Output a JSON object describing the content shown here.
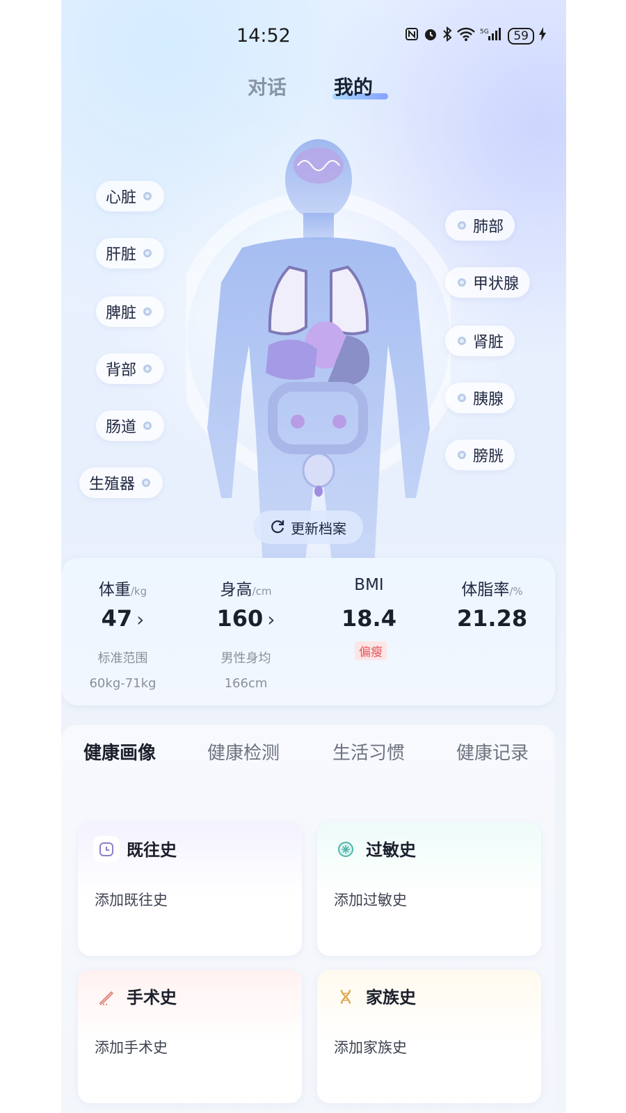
{
  "status_bar": {
    "time": "14:52",
    "icons": [
      "nfc-icon",
      "alarm-icon",
      "bluetooth-icon",
      "wifi-icon",
      "5g-signal-icon",
      "charging-icon"
    ],
    "battery": "59"
  },
  "top_tabs": [
    {
      "label": "对话",
      "active": false
    },
    {
      "label": "我的",
      "active": true
    }
  ],
  "organs_left": [
    "心脏",
    "肝脏",
    "脾脏",
    "背部",
    "肠道",
    "生殖器"
  ],
  "organs_right": [
    "肺部",
    "甲状腺",
    "肾脏",
    "胰腺",
    "膀胱"
  ],
  "refresh_label": "更新档案",
  "metrics": [
    {
      "label": "体重",
      "unit": "/kg",
      "value": "47",
      "sub1": "标准范围",
      "sub2": "60kg-71kg"
    },
    {
      "label": "身高",
      "unit": "/cm",
      "value": "160",
      "sub1": "男性身均",
      "sub2": "166cm"
    },
    {
      "label": "BMI",
      "unit": "",
      "value": "18.4",
      "badge": "偏瘦"
    },
    {
      "label": "体脂率",
      "unit": "/%",
      "value": "21.28"
    }
  ],
  "panel_tabs": [
    {
      "label": "健康画像",
      "active": true
    },
    {
      "label": "健康检测",
      "active": false
    },
    {
      "label": "生活习惯",
      "active": false
    },
    {
      "label": "健康记录",
      "active": false
    }
  ],
  "history_cards": [
    {
      "title": "既往史",
      "action": "添加既往史",
      "icon": "clock-icon",
      "accent": "#8d7fc8"
    },
    {
      "title": "过敏史",
      "action": "添加过敏史",
      "icon": "allergy-icon",
      "accent": "#4fb6a9"
    },
    {
      "title": "手术史",
      "action": "添加手术史",
      "icon": "scalpel-icon",
      "accent": "#e0877e"
    },
    {
      "title": "家族史",
      "action": "添加家族史",
      "icon": "dna-icon",
      "accent": "#e0a84f"
    }
  ]
}
